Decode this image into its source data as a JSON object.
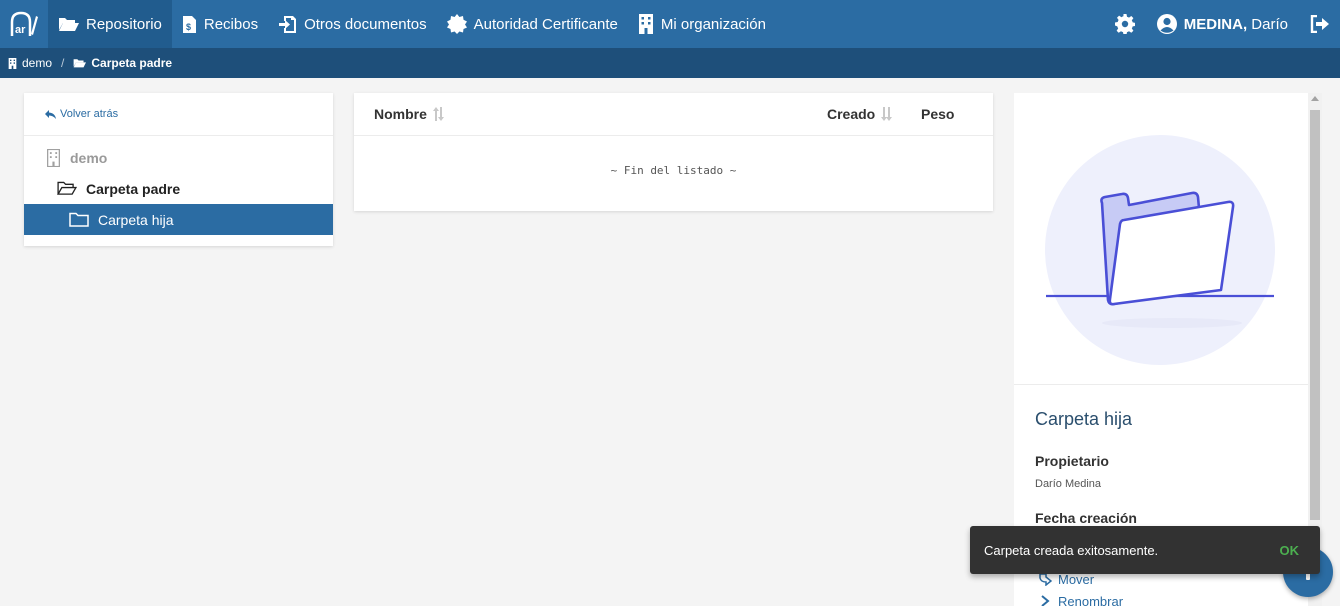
{
  "nav": {
    "items": [
      {
        "label": "Repositorio",
        "icon": "folder-open-icon",
        "active": true
      },
      {
        "label": "Recibos",
        "icon": "receipt-icon"
      },
      {
        "label": "Otros documentos",
        "icon": "sign-in-icon"
      },
      {
        "label": "Autoridad Certificante",
        "icon": "certificate-icon"
      },
      {
        "label": "Mi organización",
        "icon": "building-icon"
      }
    ],
    "user_last": "MEDINA,",
    "user_first": " Darío"
  },
  "breadcrumb": {
    "items": [
      {
        "label": "demo",
        "icon": "building-icon"
      },
      {
        "label": "Carpeta padre",
        "icon": "folder-open-icon"
      }
    ],
    "separator": "/"
  },
  "tree": {
    "back_label": "Volver atrás",
    "root": "demo",
    "parent": "Carpeta padre",
    "child": "Carpeta hija"
  },
  "listing": {
    "columns": {
      "name": "Nombre",
      "created": "Creado",
      "weight": "Peso"
    },
    "end_text": "~ Fin del listado ~"
  },
  "details": {
    "title": "Carpeta hija",
    "owner_label": "Propietario",
    "owner_value": "Darío Medina",
    "created_label": "Fecha creación",
    "actions": [
      {
        "label": "Mover",
        "icon": "move-icon"
      },
      {
        "label": "Renombrar",
        "icon": "chevron-right-icon"
      }
    ]
  },
  "toast": {
    "message": "Carpeta creada exitosamente.",
    "action": "OK"
  },
  "colors": {
    "nav_bg": "#2b6ca3",
    "crumb_bg": "#1e4f7a",
    "selected_bg": "#2b6ca3",
    "toast_action": "#4caf50",
    "illustration_stroke": "#4a4fd6"
  }
}
